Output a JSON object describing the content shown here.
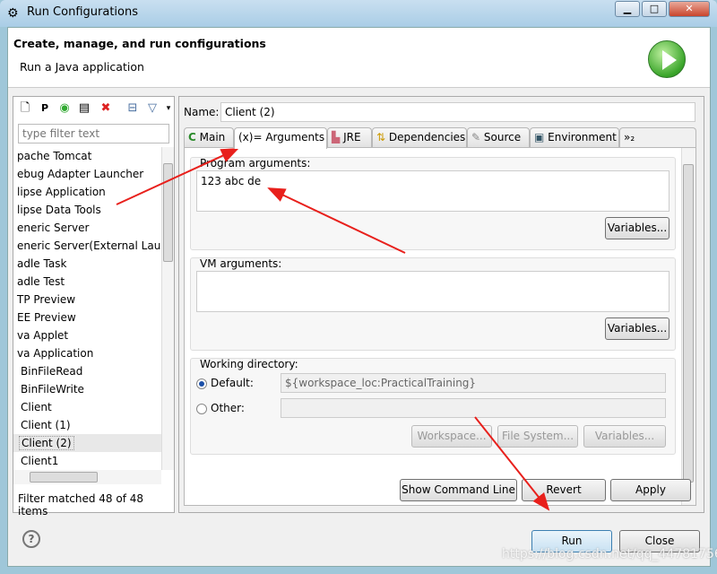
{
  "window": {
    "title": "Run Configurations",
    "buttons": {
      "minimize": "▁",
      "maximize": "□",
      "close": "✕"
    }
  },
  "header": {
    "title": "Create, manage, and run configurations",
    "subtitle": "Run a Java application",
    "logo": "run-icon"
  },
  "left": {
    "filter_placeholder": "type filter text",
    "items": [
      "pache Tomcat",
      "ebug Adapter Launcher",
      "lipse Application",
      "lipse Data Tools",
      "eneric Server",
      "eneric Server(External Laun",
      "adle Task",
      "adle Test",
      "TP Preview",
      "EE Preview",
      "va Applet",
      "va Application",
      "BinFileRead",
      "BinFileWrite",
      "Client",
      "Client (1)",
      "Client (2)",
      "Client1"
    ],
    "selected": "Client (2)",
    "status": "Filter matched 48 of 48 items"
  },
  "right": {
    "name_label": "Name:",
    "name_value": "Client (2)",
    "tabs": [
      {
        "label": "Main",
        "icon": "C"
      },
      {
        "label": "(x)= Arguments"
      },
      {
        "label": "JRE",
        "icon": "▙"
      },
      {
        "label": "Dependencies",
        "icon": "⇅"
      },
      {
        "label": "Source",
        "icon": "✎"
      },
      {
        "label": "Environment",
        "icon": "▣"
      },
      {
        "label": "»₂"
      }
    ],
    "program_args_label": "Program arguments:",
    "program_args": "123 abc de",
    "vm_args_label": "VM arguments:",
    "vm_args": "",
    "variables": "Variables...",
    "workdir_label": "Working directory:",
    "default_label": "Default:",
    "default_value": "${workspace_loc:PracticalTraining}",
    "other_label": "Other:",
    "workspace": "Workspace...",
    "filesystem": "File System...",
    "show_cmd": "Show Command Line",
    "revert": "Revert",
    "apply": "Apply"
  },
  "footer": {
    "help": "?",
    "run": "Run",
    "close": "Close"
  },
  "watermark": "https://blog.csdn.net/qq_44781756",
  "colors": {
    "annotation_arrow": "#e8201c",
    "accent": "#3c7fb1"
  }
}
